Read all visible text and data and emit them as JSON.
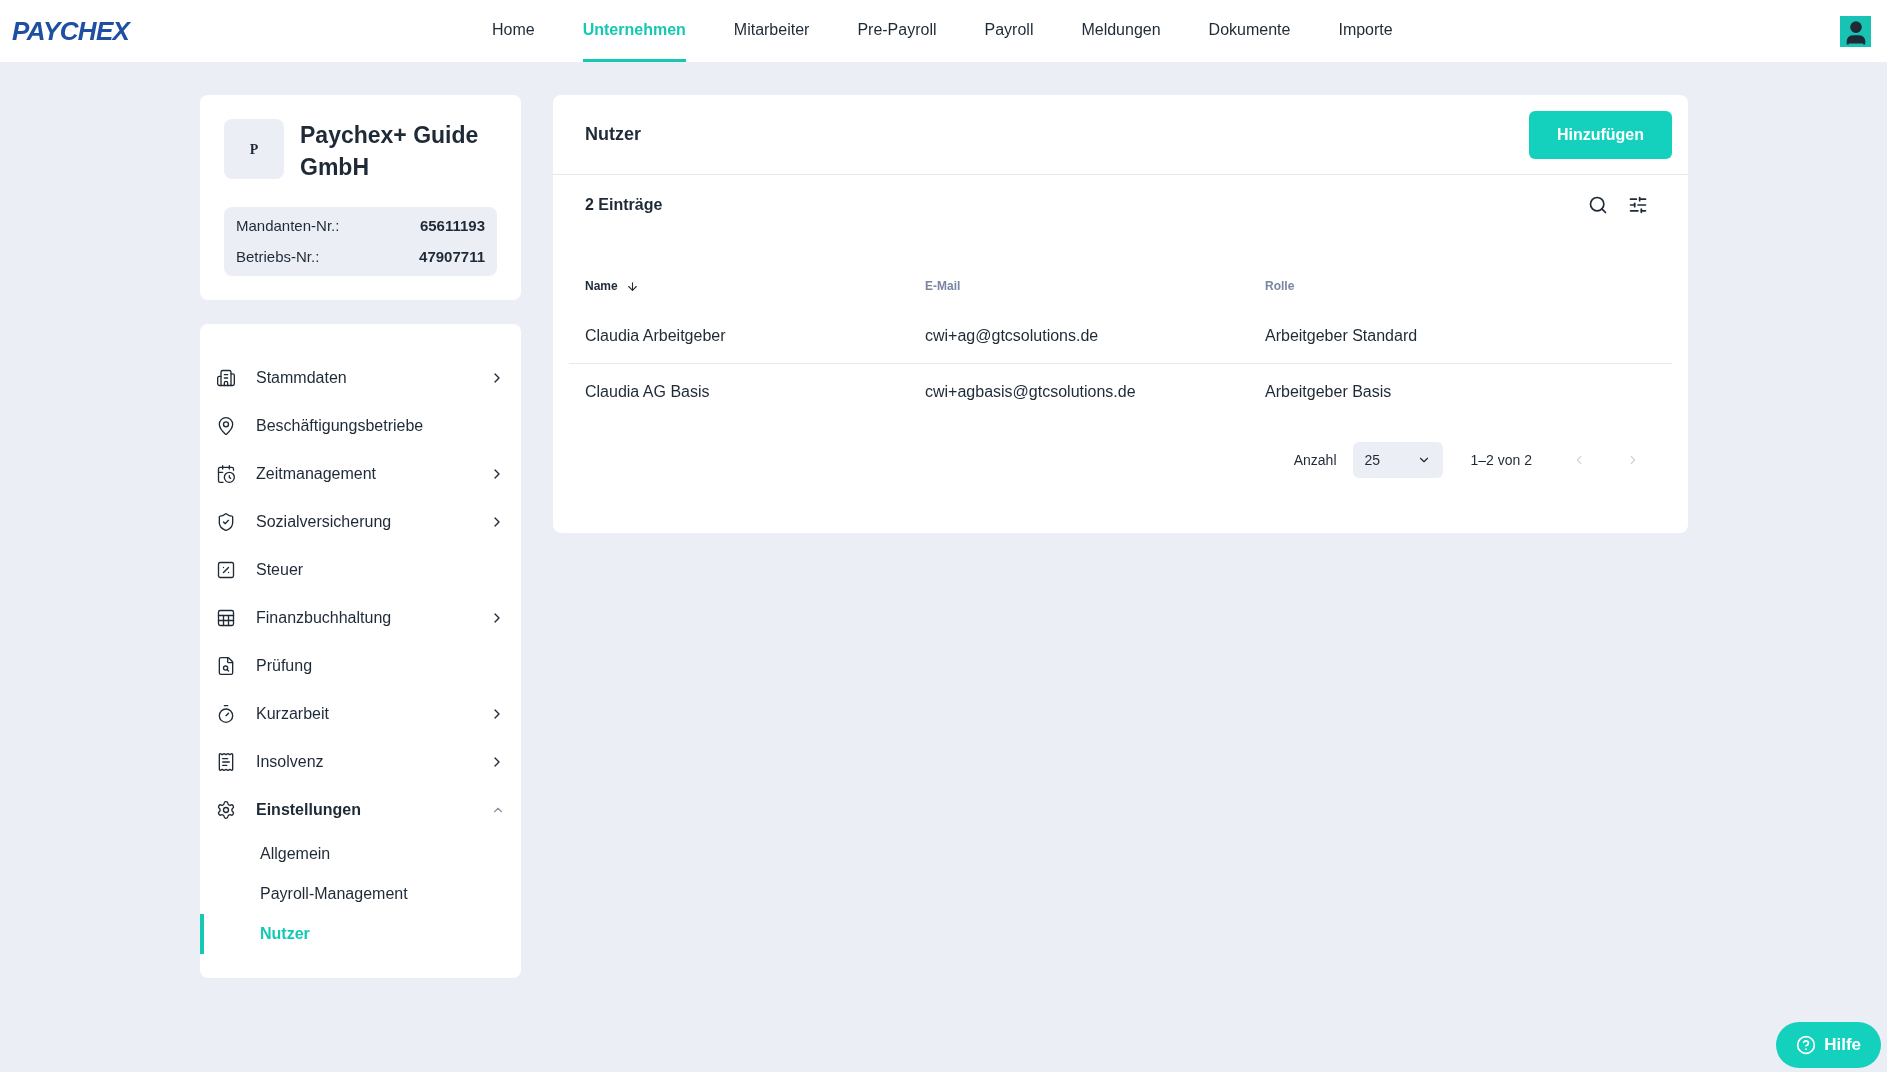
{
  "header": {
    "logo": "PAYCHEX",
    "nav": [
      {
        "label": "Home",
        "selected": false
      },
      {
        "label": "Unternehmen",
        "selected": true
      },
      {
        "label": "Mitarbeiter",
        "selected": false
      },
      {
        "label": "Pre-Payroll",
        "selected": false
      },
      {
        "label": "Payroll",
        "selected": false
      },
      {
        "label": "Meldungen",
        "selected": false
      },
      {
        "label": "Dokumente",
        "selected": false
      },
      {
        "label": "Importe",
        "selected": false
      }
    ]
  },
  "company": {
    "initial": "P",
    "name": "Paychex+ Guide GmbH",
    "fields": [
      {
        "label": "Mandanten-Nr.:",
        "value": "65611193"
      },
      {
        "label": "Betriebs-Nr.:",
        "value": "47907711"
      }
    ]
  },
  "sidebar": {
    "items": [
      {
        "label": "Stammdaten",
        "kind": "group",
        "expanded": false
      },
      {
        "label": "Beschäftigungsbetriebe",
        "kind": "link"
      },
      {
        "label": "Zeitmanagement",
        "kind": "group",
        "expanded": false
      },
      {
        "label": "Sozialversicherung",
        "kind": "group",
        "expanded": false
      },
      {
        "label": "Steuer",
        "kind": "link"
      },
      {
        "label": "Finanzbuchhaltung",
        "kind": "group",
        "expanded": false
      },
      {
        "label": "Prüfung",
        "kind": "link"
      },
      {
        "label": "Kurzarbeit",
        "kind": "group",
        "expanded": false
      },
      {
        "label": "Insolvenz",
        "kind": "group",
        "expanded": false
      },
      {
        "label": "Einstellungen",
        "kind": "group",
        "expanded": true,
        "children": [
          {
            "label": "Allgemein",
            "selected": false
          },
          {
            "label": "Payroll-Management",
            "selected": false
          },
          {
            "label": "Nutzer",
            "selected": true
          }
        ]
      }
    ]
  },
  "panel": {
    "title": "Nutzer",
    "add_button": "Hinzufügen",
    "count": "2 Einträge",
    "table": {
      "columns": [
        {
          "label": "Name",
          "sorted": true
        },
        {
          "label": "E-Mail",
          "sorted": false
        },
        {
          "label": "Rolle",
          "sorted": false
        }
      ],
      "rows": [
        [
          "Claudia Arbeitgeber",
          "cwi+ag@gtcsolutions.de",
          "Arbeitgeber Standard"
        ],
        [
          "Claudia AG Basis",
          "cwi+agbasis@gtcsolutions.de",
          "Arbeitgeber Basis"
        ]
      ]
    },
    "pagination": {
      "label": "Anzahl",
      "page_size": "25",
      "range": "1–2 von 2",
      "prev_disabled": true,
      "next_disabled": true
    }
  },
  "help_button": "Hilfe"
}
